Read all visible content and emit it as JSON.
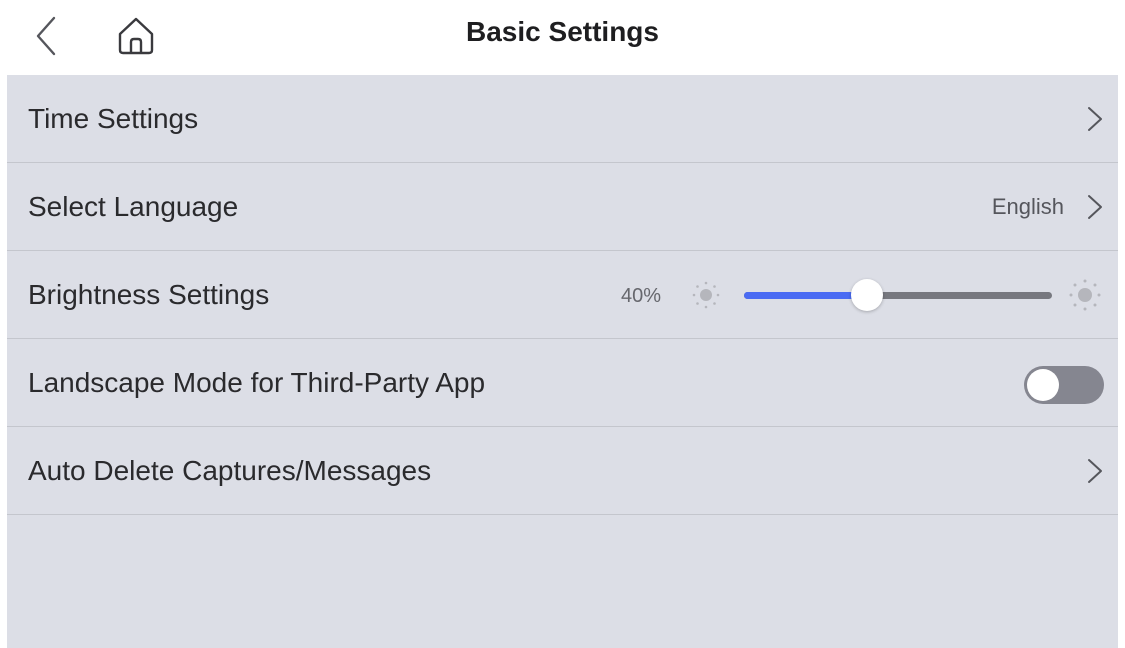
{
  "header": {
    "title": "Basic Settings",
    "back_icon": "chevron-left-icon",
    "home_icon": "home-icon"
  },
  "settings": {
    "time": {
      "label": "Time Settings"
    },
    "language": {
      "label": "Select Language",
      "value": "English"
    },
    "brightness": {
      "label": "Brightness Settings",
      "value_text": "40%",
      "level": 0.4
    },
    "landscape": {
      "label": "Landscape Mode for Third-Party App",
      "enabled": false
    },
    "auto_delete": {
      "label": "Auto Delete Captures/Messages"
    }
  },
  "colors": {
    "panel_bg": "#dcdee6",
    "accent": "#4a6bf3",
    "track": "#77787f",
    "toggle_off": "#858690"
  }
}
